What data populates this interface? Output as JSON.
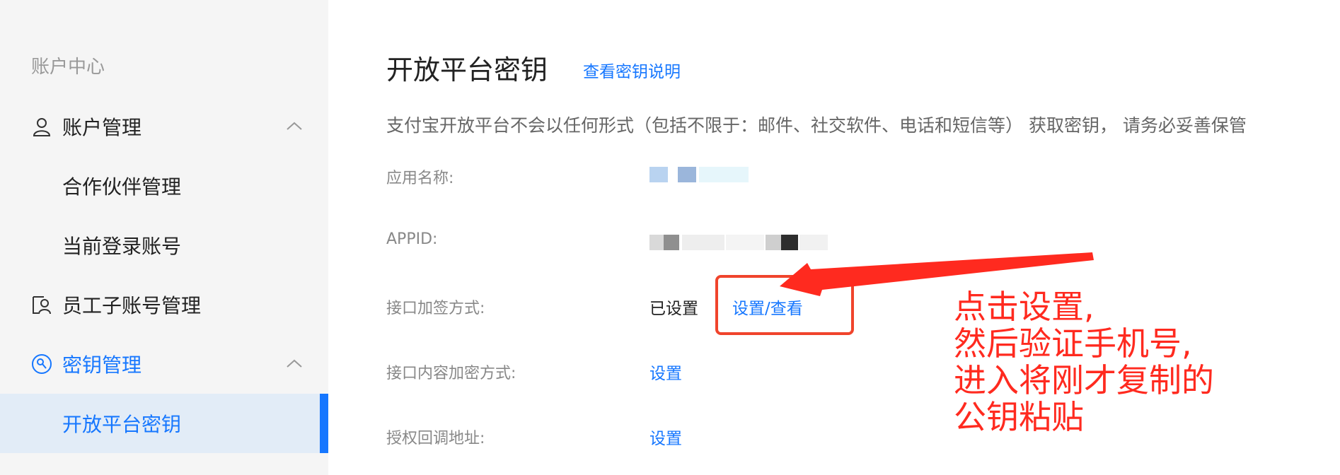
{
  "sidebar": {
    "section_title": "账户中心",
    "items": [
      {
        "label": "账户管理",
        "icon": "user-icon"
      },
      {
        "label": "合作伙伴管理"
      },
      {
        "label": "当前登录账号"
      },
      {
        "label": "员工子账号管理",
        "icon": "staff-icon"
      },
      {
        "label": "密钥管理",
        "icon": "key-search-icon"
      },
      {
        "label": "开放平台密钥"
      }
    ]
  },
  "main": {
    "title": "开放平台密钥",
    "doc_link": "查看密钥说明",
    "notice": "支付宝开放平台不会以任何形式（包括不限于：邮件、社交软件、电话和短信等） 获取密钥， 请务必妥善保管",
    "rows": [
      {
        "label": "应用名称:"
      },
      {
        "label": "APPID:"
      },
      {
        "label": "接口加签方式:",
        "status": "已设置",
        "action": "设置/查看"
      },
      {
        "label": "接口内容加密方式:",
        "action": "设置"
      },
      {
        "label": "授权回调地址:",
        "action": "设置"
      }
    ]
  },
  "annotation": {
    "lines": [
      "点击设置,",
      "然后验证手机号,",
      "进入将刚才复制的",
      "公钥粘贴"
    ],
    "color": "#ff2a1f"
  },
  "colors": {
    "accent": "#1677ff",
    "sidebar_bg": "#f5f5f5",
    "selected_bg": "#e2ecf7"
  }
}
